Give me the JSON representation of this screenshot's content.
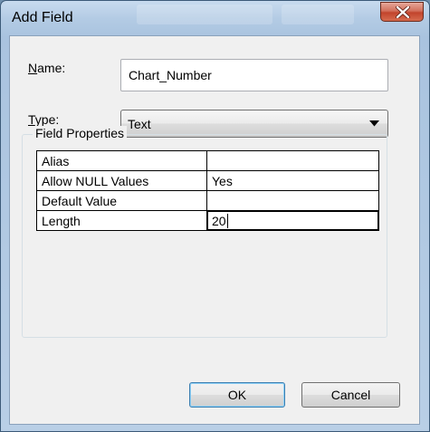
{
  "window": {
    "title": "Add Field",
    "close_icon": "close-x-icon"
  },
  "form": {
    "name_label": "Name:",
    "name_value": "Chart_Number",
    "type_label": "Type:",
    "type_value": "Text"
  },
  "field_properties": {
    "title": "Field Properties",
    "rows": [
      {
        "key": "Alias",
        "value": ""
      },
      {
        "key": "Allow NULL Values",
        "value": "Yes"
      },
      {
        "key": "Default Value",
        "value": ""
      },
      {
        "key": "Length",
        "value": "20"
      }
    ]
  },
  "buttons": {
    "ok_label": "OK",
    "cancel_label": "Cancel"
  }
}
